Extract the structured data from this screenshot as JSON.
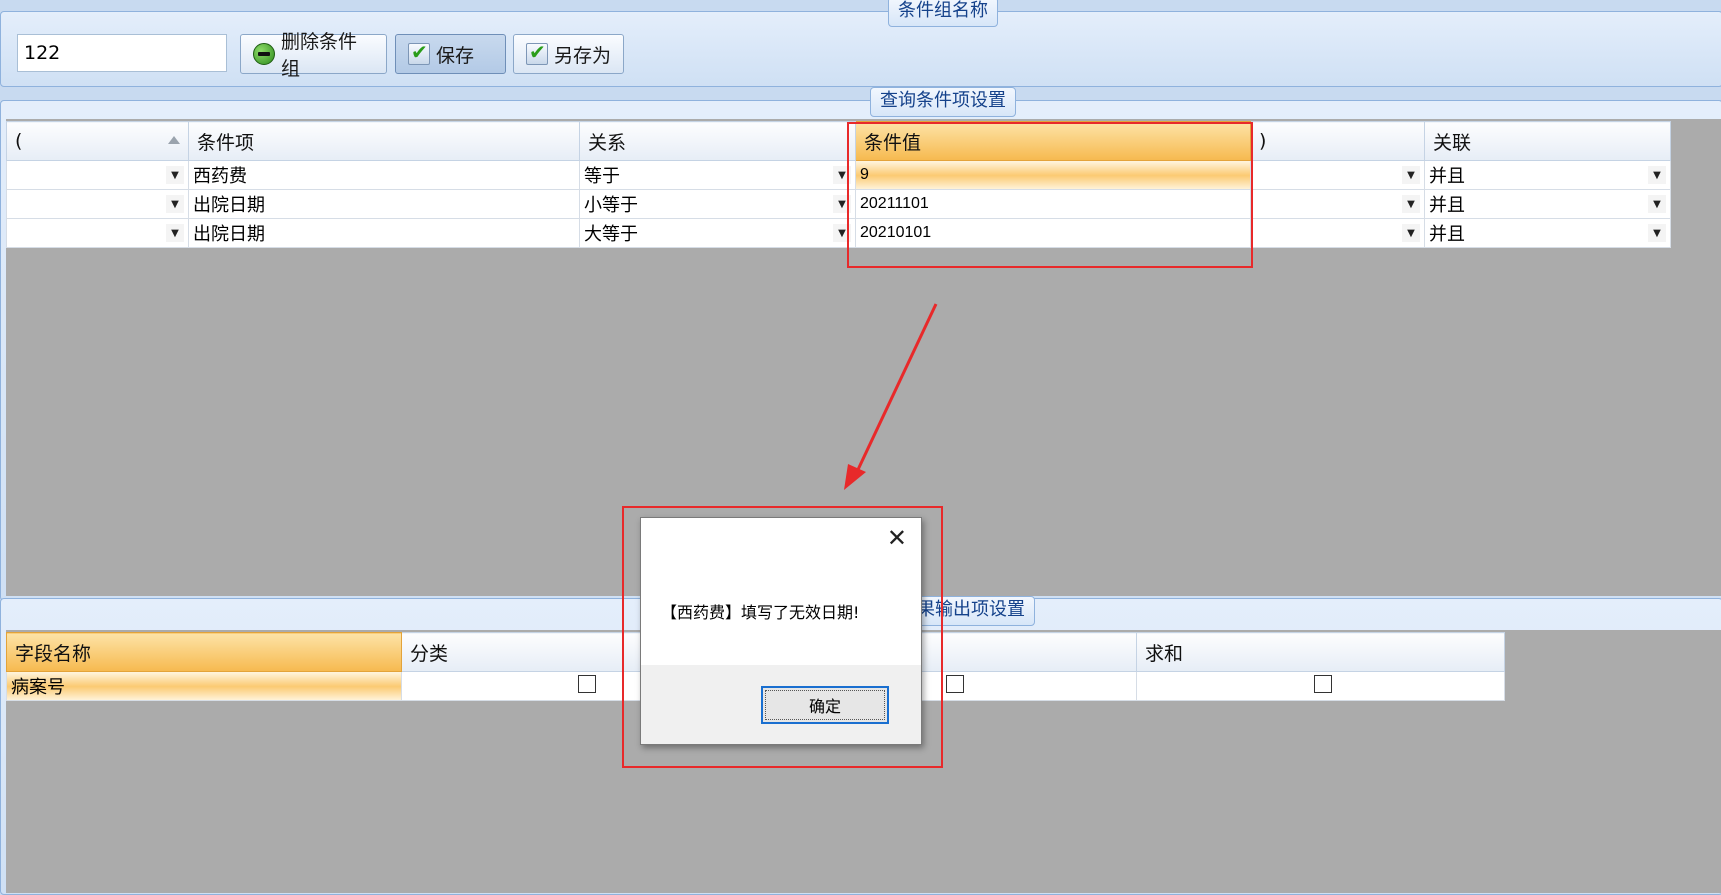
{
  "top_group": {
    "legend": "条件组名称",
    "name_value": "122",
    "buttons": [
      {
        "label": "删除条件组",
        "icon": "delete-icon"
      },
      {
        "label": "保存",
        "icon": "check-icon"
      },
      {
        "label": "另存为",
        "icon": "check-icon"
      }
    ]
  },
  "query_group": {
    "legend": "查询条件项设置",
    "columns": [
      "(",
      "条件项",
      "关系",
      "条件值",
      ")",
      "关联"
    ],
    "rows": [
      {
        "open": "",
        "item": "西药费",
        "relation": "等于",
        "value": "9",
        "close": "",
        "link": "并且"
      },
      {
        "open": "",
        "item": "出院日期",
        "relation": "小等于",
        "value": "20211101",
        "close": "",
        "link": "并且"
      },
      {
        "open": "",
        "item": "出院日期",
        "relation": "大等于",
        "value": "20210101",
        "close": "",
        "link": "并且"
      }
    ]
  },
  "output_group": {
    "legend": "果输出项设置",
    "columns": [
      "字段名称",
      "分类",
      "",
      "求和"
    ],
    "rows": [
      {
        "field": "病案号"
      }
    ]
  },
  "dialog": {
    "message": "【西药费】填写了无效日期!",
    "ok_label": "确定",
    "close_icon": "close-icon"
  },
  "colors": {
    "annotation": "#e8292a",
    "highlight": "#f6b94f",
    "grid_bg": "#ababab"
  }
}
